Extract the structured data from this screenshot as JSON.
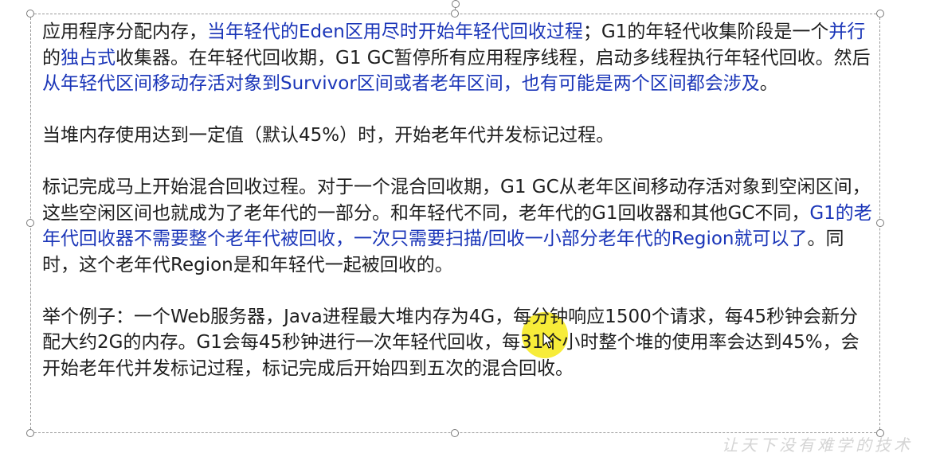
{
  "paragraphs": [
    {
      "segments": [
        {
          "text": "应用程序分配内存，",
          "highlight": false
        },
        {
          "text": "当年轻代的Eden区用尽时开始年轻代回收过程",
          "highlight": true
        },
        {
          "text": "；G1的年轻代收集阶段是一个",
          "highlight": false
        },
        {
          "text": "并行",
          "highlight": true
        },
        {
          "text": "的",
          "highlight": false
        },
        {
          "text": "独占式",
          "highlight": true
        },
        {
          "text": "收集器。在年轻代回收期，G1 GC暂停所有应用程序线程，启动多线程执行年轻代回收。然后",
          "highlight": false
        },
        {
          "text": "从年轻代区间移动存活对象到Survivor区间或者老年区间，也有可能是两个区间都会涉及",
          "highlight": true
        },
        {
          "text": "。",
          "highlight": false
        }
      ]
    },
    {
      "segments": [
        {
          "text": "当堆内存使用达到一定值（默认45%）时，开始老年代并发标记过程。",
          "highlight": false
        }
      ]
    },
    {
      "segments": [
        {
          "text": "标记完成马上开始混合回收过程。对于一个混合回收期，G1 GC从老年区间移动存活对象到空闲区间，这些空闲区间也就成为了老年代的一部分。和年轻代不同，老年代的G1回收器和其他GC不同，",
          "highlight": false
        },
        {
          "text": "G1的老年代回收器不需要整个老年代被回收，一次只需要扫描/回收一小部分老年代的Region就可以了",
          "highlight": true
        },
        {
          "text": "。同时，这个老年代Region是和年轻代一起被回收的。",
          "highlight": false
        }
      ]
    },
    {
      "segments": [
        {
          "text": "举个例子：一个Web服务器，Java进程最大堆内存为4G，每分钟响应1500个请求，每45秒钟会新分配大约2G的内存。G1会每45秒钟进行一次年轻代回收，每31个小时整个堆的使用率会达到45%，会开始老年代并发标记过程，标记完成后开始四到五次的混合回收。",
          "highlight": false
        }
      ]
    }
  ],
  "watermark": "让天下没有难学的技术",
  "colors": {
    "text": "#1e1e1e",
    "highlight": "#1a35b8",
    "cursor_highlight": "#f6ea28",
    "selection_border": "#9a9a9a"
  },
  "icons": {
    "cursor": "mouse-pointer-icon"
  }
}
